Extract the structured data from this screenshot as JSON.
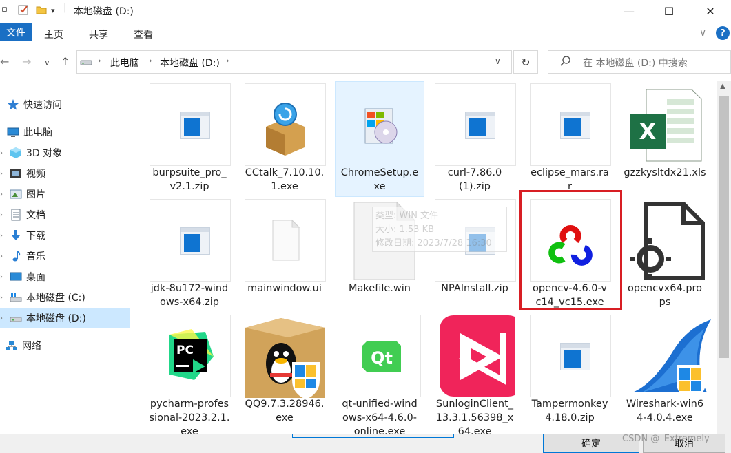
{
  "window": {
    "title": "本地磁盘 (D:)",
    "minimize_glyph": "—",
    "maximize_glyph": "☐",
    "close_glyph": "✕"
  },
  "ribbon": {
    "tabs": [
      "文件",
      "主页",
      "共享",
      "查看"
    ],
    "help_glyph": "?",
    "expand_glyph": "∨"
  },
  "address": {
    "breadcrumb": [
      "此电脑",
      "本地磁盘 (D:)"
    ],
    "search_placeholder": "在 本地磁盘 (D:) 中搜索"
  },
  "nav_pane": {
    "items": [
      {
        "label": "快速访问",
        "icon": "star-icon"
      },
      {
        "label": "此电脑",
        "icon": "computer-icon"
      },
      {
        "label": "3D 对象",
        "icon": "cube-icon"
      },
      {
        "label": "视频",
        "icon": "video-icon"
      },
      {
        "label": "图片",
        "icon": "pictures-icon"
      },
      {
        "label": "文档",
        "icon": "documents-icon"
      },
      {
        "label": "下载",
        "icon": "download-icon"
      },
      {
        "label": "音乐",
        "icon": "music-icon"
      },
      {
        "label": "桌面",
        "icon": "desktop-icon"
      },
      {
        "label": "本地磁盘 (C:)",
        "icon": "drive-icon"
      },
      {
        "label": "本地磁盘 (D:)",
        "icon": "drive-icon"
      },
      {
        "label": "网络",
        "icon": "network-icon"
      }
    ]
  },
  "files": [
    {
      "name": "burpsuite_pro_v2.1.zip",
      "lines": [
        "burpsuite_pro_",
        "v2.1.zip"
      ],
      "icon": "generic-file-icon"
    },
    {
      "name": "CCtalk_7.10.10.1.exe",
      "lines": [
        "CCtalk_7.10.10.",
        "1.exe"
      ],
      "icon": "cctalk-icon"
    },
    {
      "name": "ChromeSetup.exe",
      "lines": [
        "ChromeSetup.e",
        "xe"
      ],
      "icon": "installer-icon"
    },
    {
      "name": "curl-7.86.0 (1).zip",
      "lines": [
        "curl-7.86.0",
        "(1).zip"
      ],
      "icon": "generic-file-icon"
    },
    {
      "name": "eclipse_mars.rar",
      "lines": [
        "eclipse_mars.ra",
        "r"
      ],
      "icon": "generic-file-icon"
    },
    {
      "name": "gzzkysltdx21.xls",
      "lines": [
        "gzzkysltdx21.xls"
      ],
      "icon": "excel-icon"
    },
    {
      "name": "jdk-8u172-windows-x64.zip",
      "lines": [
        "jdk-8u172-wind",
        "ows-x64.zip"
      ],
      "icon": "generic-file-icon"
    },
    {
      "name": "mainwindow.ui",
      "lines": [
        "mainwindow.ui"
      ],
      "icon": "blank-file-icon"
    },
    {
      "name": "Makefile.win",
      "lines": [
        "Makefile.win"
      ],
      "icon": "blank-file-icon"
    },
    {
      "name": "NPAInstall.zip",
      "lines": [
        "NPAInstall.zip"
      ],
      "icon": "generic-file-icon"
    },
    {
      "name": "opencv-4.6.0-vc14_vc15.exe",
      "lines": [
        "opencv-4.6.0-v",
        "c14_vc15.exe"
      ],
      "icon": "opencv-icon"
    },
    {
      "name": "opencvx64.props",
      "lines": [
        "opencvx64.pro",
        "ps"
      ],
      "icon": "settings-file-icon"
    },
    {
      "name": "pycharm-professional-2023.2.1.exe",
      "lines": [
        "pycharm-profes",
        "sional-2023.2.1.",
        "exe"
      ],
      "icon": "pycharm-icon"
    },
    {
      "name": "QQ9.7.3.28946.exe",
      "lines": [
        "QQ9.7.3.28946.",
        "exe"
      ],
      "icon": "qq-icon"
    },
    {
      "name": "qt-unified-windows-x64-4.6.0-online.exe",
      "lines": [
        "qt-unified-wind",
        "ows-x64-4.6.0-",
        "online.exe"
      ],
      "icon": "qt-icon"
    },
    {
      "name": "SunloginClient_13.3.1.56398_x64.exe",
      "lines": [
        "SunloginClient_",
        "13.3.1.56398_x",
        "64.exe"
      ],
      "icon": "sunlogin-icon"
    },
    {
      "name": "Tampermonkey 4.18.0.zip",
      "lines": [
        "Tampermonkey",
        "4.18.0.zip"
      ],
      "icon": "generic-file-icon"
    },
    {
      "name": "Wireshark-win64-4.0.4.exe",
      "lines": [
        "Wireshark-win6",
        "4-4.0.4.exe"
      ],
      "icon": "wireshark-icon"
    }
  ],
  "tooltip": {
    "lines": [
      "类型: WIN 文件",
      "大小: 1.53 KB",
      "修改日期: 2023/7/28 16:30"
    ]
  },
  "dialog_buttons": {
    "ok": "确定",
    "cancel": "取消"
  },
  "watermark": "CSDN @_Extremely"
}
